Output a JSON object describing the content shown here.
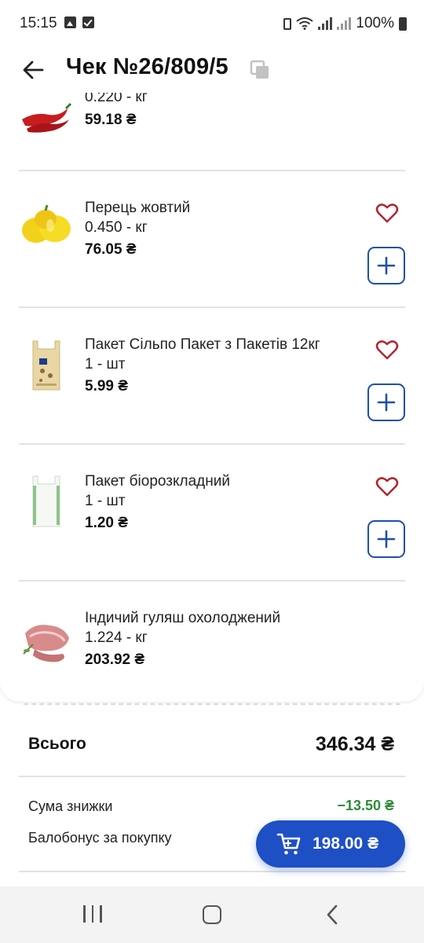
{
  "status_bar": {
    "time": "15:15",
    "battery": "100%"
  },
  "header": {
    "title": "Чек №26/809/5"
  },
  "items": [
    {
      "name": "",
      "qty": "0.220 - кг",
      "price": "59.18 ₴",
      "icon": "red-chili-pepper-image",
      "has_actions": false
    },
    {
      "name": "Перець жовтий",
      "qty": "0.450 - кг",
      "price": "76.05 ₴",
      "icon": "yellow-bell-pepper-image",
      "has_actions": true
    },
    {
      "name": "Пакет Сільпо Пакет з Пакетів 12кг",
      "qty": "1 - шт",
      "price": "5.99 ₴",
      "icon": "kraft-shopping-bag-image",
      "has_actions": true
    },
    {
      "name": "Пакет біорозкладний",
      "qty": "1 - шт",
      "price": "1.20 ₴",
      "icon": "white-bio-bag-image",
      "has_actions": true
    },
    {
      "name": "Індичий гуляш охолоджений",
      "qty": "1.224 - кг",
      "price": "203.92 ₴",
      "icon": "turkey-meat-image",
      "has_actions": false
    }
  ],
  "summary": {
    "total_label": "Всього",
    "total_value": "346.34 ₴",
    "discount_label": "Сума знижки",
    "discount_value": "−13.50 ₴",
    "bonus_label": "Балобонус за покупку"
  },
  "cart_button": {
    "value": "198.00 ₴"
  },
  "colors": {
    "accent": "#1e4fc4",
    "plus_border": "#1f4fa8",
    "heart": "#b3262e",
    "discount": "#2e8b3a"
  }
}
